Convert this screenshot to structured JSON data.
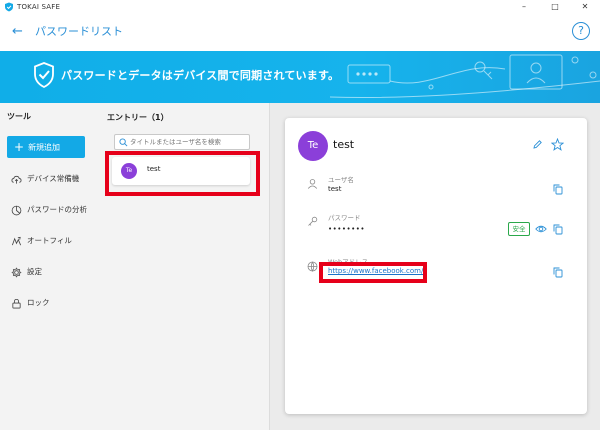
{
  "titlebar": {
    "app_name": "TOKAI SAFE",
    "minimize": "–",
    "maximize": "□",
    "close": "✕"
  },
  "header": {
    "back_glyph": "←",
    "title": "パスワードリスト",
    "help_glyph": "?"
  },
  "banner": {
    "message": "パスワードとデータはデバイス間で同期されています。"
  },
  "sidebar": {
    "title": "ツール",
    "add_button": "新規追加",
    "items": [
      {
        "label": "デバイス常備機",
        "icon": "cloud-upload-icon"
      },
      {
        "label": "パスワードの分析",
        "icon": "analysis-icon"
      },
      {
        "label": "オートフィル",
        "icon": "autofill-icon"
      },
      {
        "label": "設定",
        "icon": "gear-icon"
      },
      {
        "label": "ロック",
        "icon": "lock-icon"
      }
    ]
  },
  "entries": {
    "title": "エントリー（1）",
    "search_placeholder": "タイトルまたはユーザ名を検索",
    "list": [
      {
        "initials": "Te",
        "name": "test"
      }
    ]
  },
  "detail": {
    "initials": "Te",
    "name": "test",
    "username_label": "ユーザ名",
    "username_value": "test",
    "password_label": "パスワード",
    "password_value": "••••••••",
    "safe_badge": "安全",
    "web_label": "Webアドレス",
    "web_value": "https://www.facebook.com/"
  },
  "colors": {
    "accent": "#13a9e6",
    "avatar": "#8b3fd9",
    "highlight": "#e6001a",
    "safe": "#2aa84a"
  }
}
